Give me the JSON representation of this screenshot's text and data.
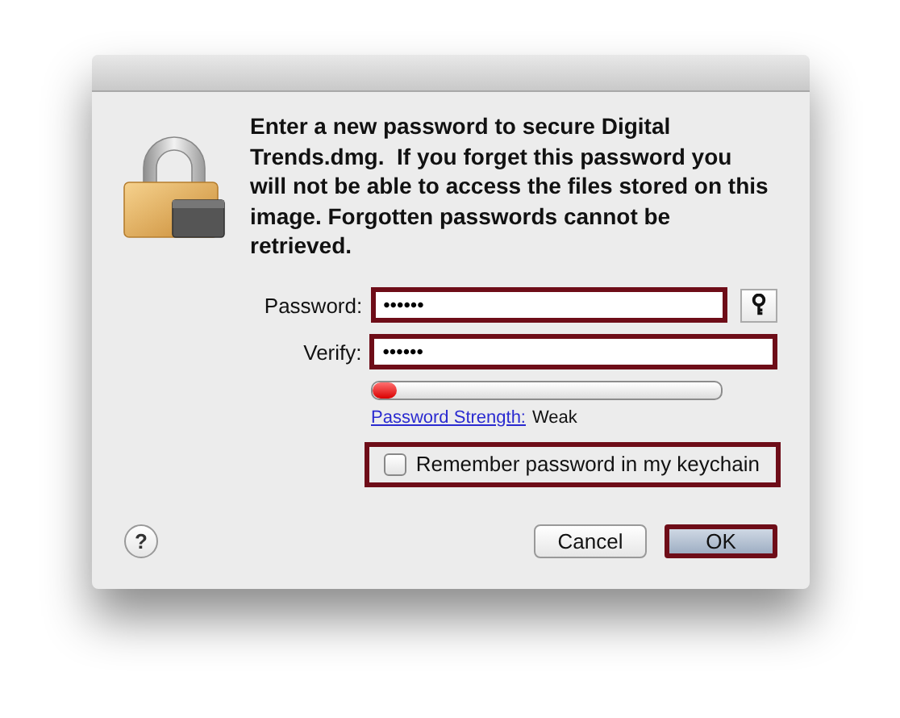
{
  "dialog": {
    "message": "Enter a new password to secure Digital Trends.dmg.  If you forget this password you will not be able to access the files stored on this image. Forgotten passwords cannot be retrieved.",
    "fields": [
      {
        "label": "Password:",
        "value": "••••••",
        "highlighted": true,
        "kind": "with-key"
      },
      {
        "label": "Verify:",
        "value": "••••••",
        "highlighted": true,
        "kind": "plain"
      }
    ],
    "strength": {
      "level": 0.07,
      "link": "Password Strength:",
      "value": "Weak"
    },
    "keychain": {
      "label": "Remember password in my keychain",
      "checked": false,
      "highlighted": true
    },
    "help": "?",
    "buttons": [
      {
        "label": "Cancel",
        "default": false,
        "highlighted": false
      },
      {
        "label": "OK",
        "default": true,
        "highlighted": true
      }
    ]
  }
}
